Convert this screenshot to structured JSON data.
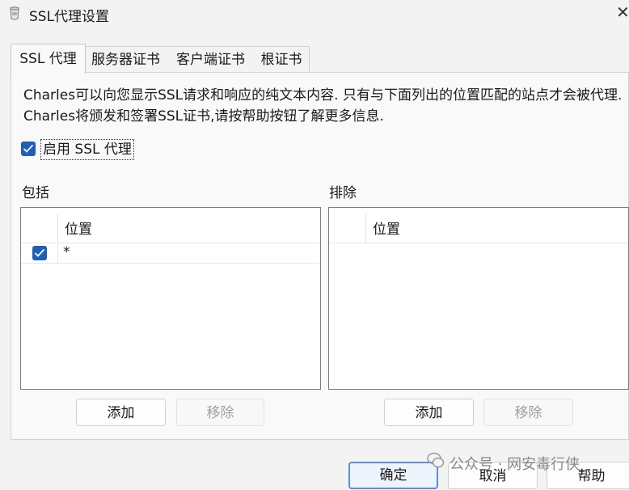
{
  "window": {
    "title": "SSL代理设置"
  },
  "tabs": [
    {
      "label": "SSL 代理",
      "active": true
    },
    {
      "label": "服务器证书",
      "active": false
    },
    {
      "label": "客户端证书",
      "active": false
    },
    {
      "label": "根证书",
      "active": false
    }
  ],
  "description": "Charles可以向您显示SSL请求和响应的纯文本内容. 只有与下面列出的位置匹配的站点才会被代理. Charles将颁发和签署SSL证书,请按帮助按钮了解更多信息.",
  "enable_ssl": {
    "label": "启用 SSL 代理",
    "checked": true
  },
  "include": {
    "title": "包括",
    "column": "位置",
    "rows": [
      {
        "checked": true,
        "location": "*"
      }
    ],
    "add_label": "添加",
    "remove_label": "移除"
  },
  "exclude": {
    "title": "排除",
    "column": "位置",
    "rows": [],
    "add_label": "添加",
    "remove_label": "移除"
  },
  "footer": {
    "ok_label": "确定",
    "cancel_label": "取消",
    "help_label": "帮助"
  },
  "watermark": "公众号 · 网安毒行侠",
  "colors": {
    "accent": "#1f5fb4",
    "background": "#f3f3f3",
    "panel": "#f9f9f9"
  }
}
